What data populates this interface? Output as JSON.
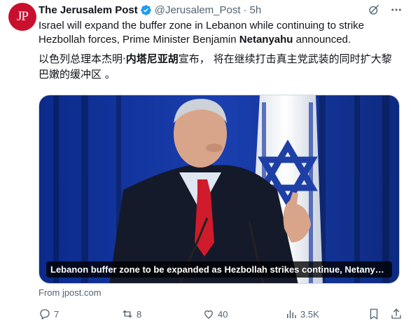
{
  "author": {
    "avatar_text": "JP",
    "name": "The Jerusalem Post",
    "handle": "@Jerusalem_Post",
    "separator": "·",
    "time": "5h"
  },
  "tweet": {
    "text_part1": "Israel will expand the buffer zone in Lebanon while continuing to strike Hezbollah forces, Prime Minister Benjamin ",
    "text_bold": "Netanyahu",
    "text_part2": " announced.",
    "cn_part1": "以色列总理本杰明·",
    "cn_bold": "内塔尼亚胡",
    "cn_part2": "宣布， 将在继续打击真主党武装的同时扩大黎巴嫩的缓冲区 。"
  },
  "media": {
    "caption": "Lebanon buffer zone to be expanded as Hezbollah strikes continue, Netanyah...",
    "source": "From jpost.com"
  },
  "actions": {
    "replies": "7",
    "reposts": "8",
    "likes": "40",
    "views": "3.5K"
  }
}
